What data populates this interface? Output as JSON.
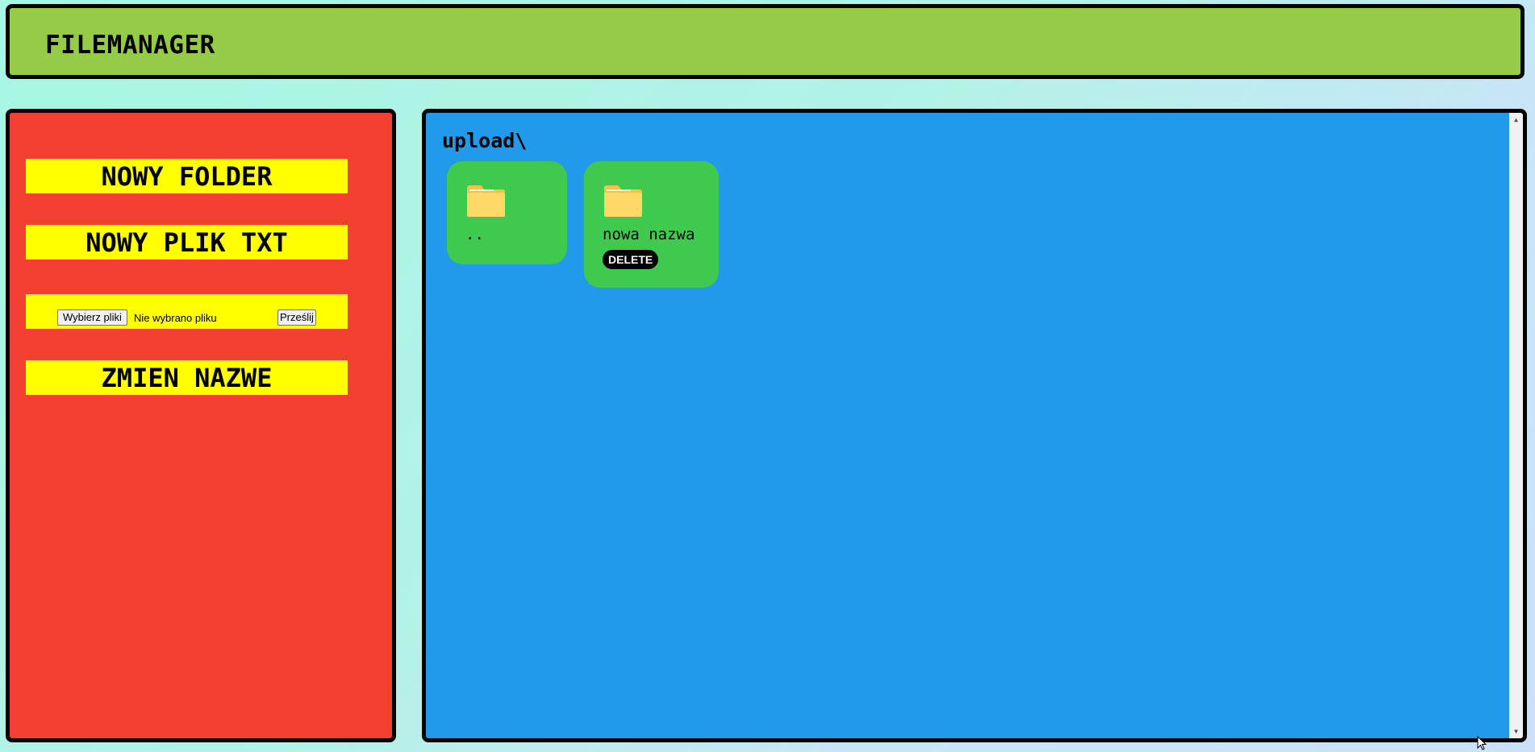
{
  "header": {
    "title": "FILEMANAGER"
  },
  "sidebar": {
    "new_folder_label": "NOWY FOLDER",
    "new_txt_label": "NOWY PLIK TXT",
    "upload": {
      "choose_label": "Wybierz pliki",
      "status_text": "Nie wybrano pliku",
      "submit_label": "Prześlij"
    },
    "rename_label": "ZMIEN NAZWE"
  },
  "main": {
    "path": "upload\\",
    "items": [
      {
        "name": "..",
        "icon": "folder-icon",
        "deletable": false
      },
      {
        "name": "nowa nazwa",
        "icon": "folder-icon",
        "deletable": true,
        "delete_label": "DELETE"
      }
    ]
  },
  "colors": {
    "background": "#b3f2e6",
    "header": "#94cc47",
    "sidebar": "#f23f31",
    "sidebar_buttons": "#ffff00",
    "main_panel": "#219ae9",
    "tile": "#40c94f",
    "folder": "#ffd868",
    "border": "#000000"
  }
}
